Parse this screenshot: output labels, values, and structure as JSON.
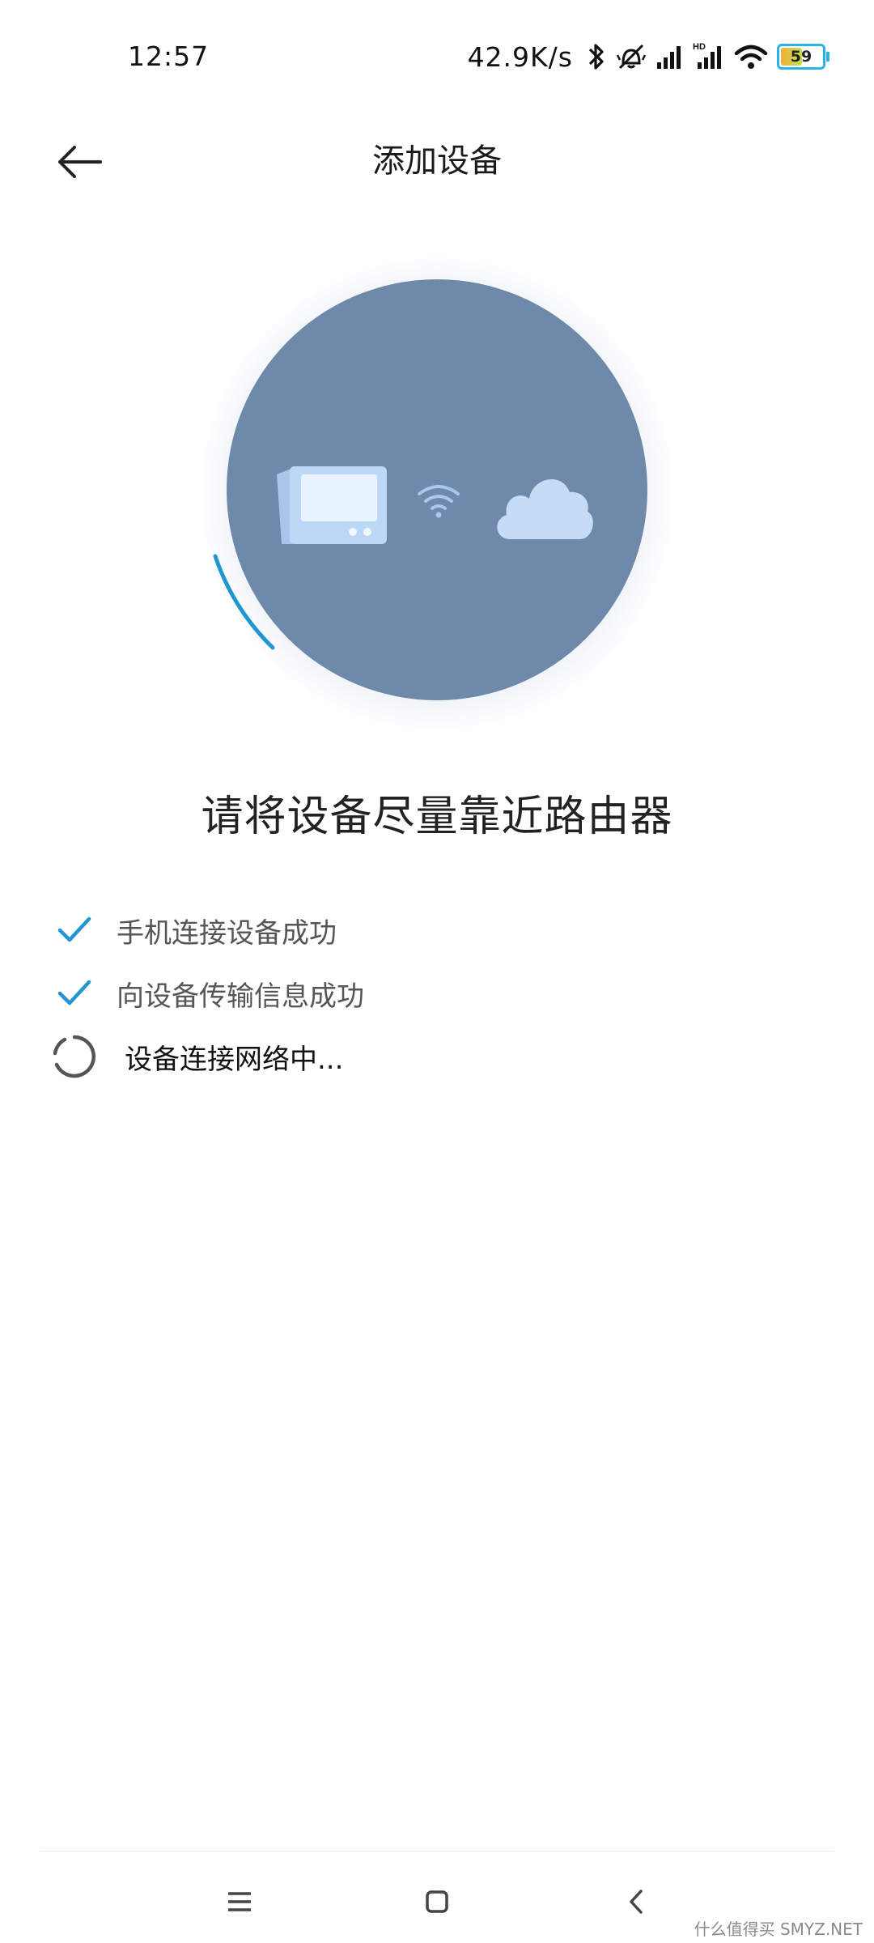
{
  "status_bar": {
    "time": "12:57",
    "net_speed": "42.9K/s",
    "icons": [
      "bluetooth-icon",
      "vibrate-off-icon",
      "signal-icon",
      "hd-signal-icon",
      "wifi-icon"
    ],
    "battery_level": "59",
    "accent_color": "#2bb3e9"
  },
  "header": {
    "title": "添加设备",
    "back_icon": "arrow-left-icon"
  },
  "illustration": {
    "circle_color": "#6f89aa",
    "arc_color": "#2196d3",
    "icons": [
      "display-device-icon",
      "wifi-signal-icon",
      "cloud-icon"
    ]
  },
  "prompt": "请将设备尽量靠近路由器",
  "steps": [
    {
      "label": "手机连接设备成功",
      "status": "done",
      "icon": "check-icon"
    },
    {
      "label": "向设备传输信息成功",
      "status": "done",
      "icon": "check-icon"
    },
    {
      "label": "设备连接网络中...",
      "status": "in-progress",
      "icon": "spinner-icon"
    }
  ],
  "nav_bar": {
    "icons": [
      "menu-icon",
      "home-square-icon",
      "back-chevron-icon"
    ]
  },
  "watermark": "什么值得买 SMYZ.NET"
}
